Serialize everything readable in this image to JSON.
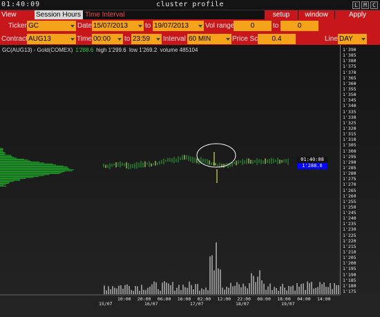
{
  "window": {
    "clock": "01:40:09",
    "title": "cluster profile",
    "buttons": [
      "L",
      "M",
      "C"
    ]
  },
  "menu": {
    "view_dom": "View DOM",
    "session_hours": "Session Hours",
    "time_interval": "Time Interval",
    "setup": "setup",
    "window": "window",
    "apply": "Apply"
  },
  "controls": {
    "ticker_label": "Ticker",
    "ticker": "GC",
    "date_label": "Date",
    "date_from": "15/07/2013",
    "date_to_label": "to",
    "date_to": "19/07/2013",
    "vol_range_label": "Vol range",
    "vol_from": "0",
    "vol_to_label": "to",
    "vol_to": "0",
    "contract_label": "Contract",
    "contract": "AUG13",
    "time_label": "Time",
    "time_from": "00:00",
    "time_to_label": "to",
    "time_to": "23:59",
    "interval_label": "Interval",
    "interval": "60 MIN",
    "price_scale_label": "Price Scale",
    "price_scale": "0.4",
    "line_label": "Line",
    "line": "DAY"
  },
  "chart": {
    "instrument": "GC(AUG13) - Gold(COMEX)",
    "last": "1'288.6",
    "high": "high 1'299.6",
    "low": "low 1'269.2",
    "volume": "volume 485104",
    "tag_time": "01:40:08",
    "tag_price": "1'288.6",
    "price_color": "#2ecc40",
    "tag_color": "#0000ff",
    "y_ticks": [
      "1'390",
      "1'385",
      "1'380",
      "1'375",
      "1'370",
      "1'365",
      "1'360",
      "1'355",
      "1'350",
      "1'345",
      "1'340",
      "1'335",
      "1'330",
      "1'325",
      "1'320",
      "1'315",
      "1'310",
      "1'305",
      "1'300",
      "1'295",
      "1'290",
      "1'285",
      "1'280",
      "1'275",
      "1'270",
      "1'265",
      "1'260",
      "1'255",
      "1'250",
      "1'245",
      "1'240",
      "1'235",
      "1'230",
      "1'225",
      "1'220",
      "1'215",
      "1'210",
      "1'205",
      "1'200",
      "1'195",
      "1'190",
      "1'185",
      "1'180",
      "1'175"
    ],
    "x_ticks_time": [
      "10:00",
      "20:00",
      "06:00",
      "16:00",
      "02:00",
      "12:00",
      "22:00",
      "08:00",
      "18:00",
      "04:00",
      "14:00"
    ],
    "x_ticks_date": [
      "15/07",
      "16/07",
      "17/07",
      "18/07",
      "19/07"
    ]
  }
}
